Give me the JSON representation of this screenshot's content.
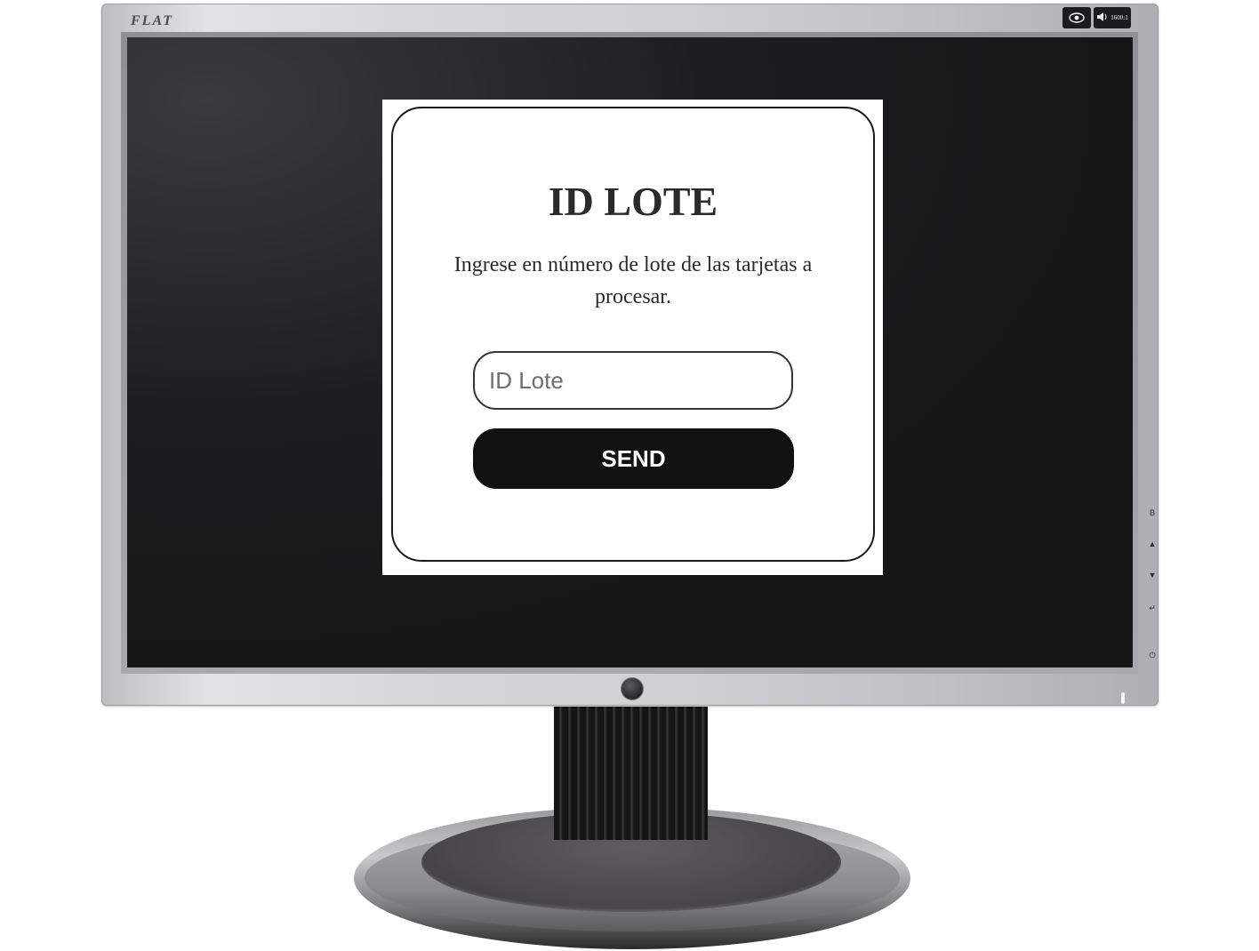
{
  "monitor": {
    "brand": "FLAT",
    "energy_ratio": "1600:1",
    "side_buttons": [
      "B",
      "▲",
      "▼",
      "↵",
      "⏻"
    ]
  },
  "card": {
    "title": "ID LOTE",
    "description": "Ingrese en número de lote de las tarjetas a procesar.",
    "input_placeholder": "ID Lote",
    "input_value": "",
    "button_label": "SEND"
  },
  "colors": {
    "screen_bg": "#161616",
    "card_bg": "#ffffff",
    "button_bg": "#111111",
    "button_text": "#ffffff"
  }
}
